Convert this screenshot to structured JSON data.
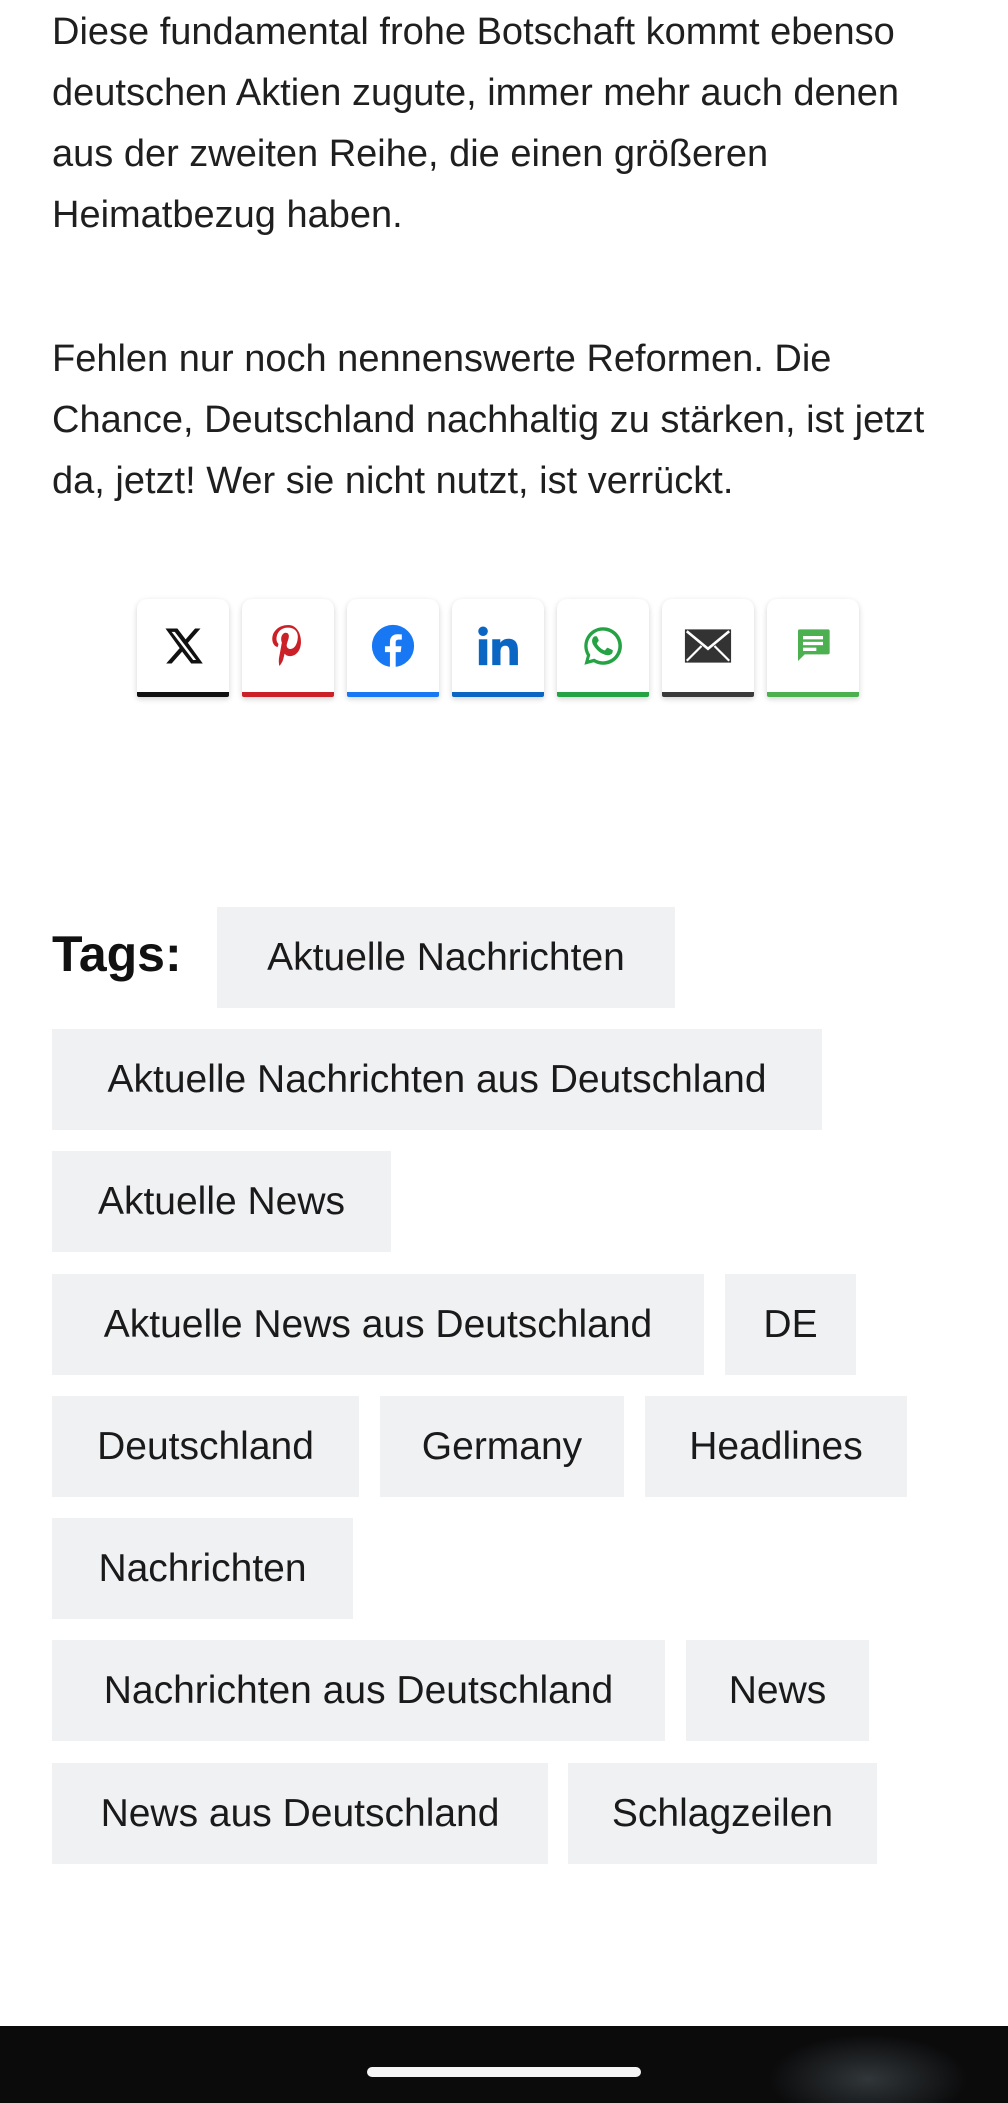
{
  "article": {
    "paragraphs": [
      "Diese fundamental frohe Botschaft kommt ebenso deutschen Aktien zugute, immer mehr auch denen aus der zweiten Reihe, die einen größeren Heimatbezug haben.",
      "Fehlen nur noch nennenswerte Reformen. Die Chance, Deutschland nachhaltig zu stärken, ist jetzt da, jetzt! Wer sie nicht nutzt, ist verrückt."
    ]
  },
  "share": {
    "buttons": [
      {
        "icon": "x-icon",
        "color": "#000000"
      },
      {
        "icon": "pinterest-icon",
        "color": "#cb2027"
      },
      {
        "icon": "facebook-icon",
        "color": "#1877f2"
      },
      {
        "icon": "linkedin-icon",
        "color": "#0a66c2"
      },
      {
        "icon": "whatsapp-icon",
        "color": "#25a244"
      },
      {
        "icon": "email-icon",
        "color": "#333333"
      },
      {
        "icon": "comment-icon",
        "color": "#4caf50"
      }
    ]
  },
  "tags": {
    "label": "Tags:",
    "items": [
      "Aktuelle Nachrichten",
      "Aktuelle Nachrichten aus Deutschland",
      "Aktuelle News",
      "Aktuelle News aus Deutschland",
      "DE",
      "Deutschland",
      "Germany",
      "Headlines",
      "Nachrichten",
      "Nachrichten aus Deutschland",
      "News",
      "News aus Deutschland",
      "Schlagzeilen"
    ]
  }
}
